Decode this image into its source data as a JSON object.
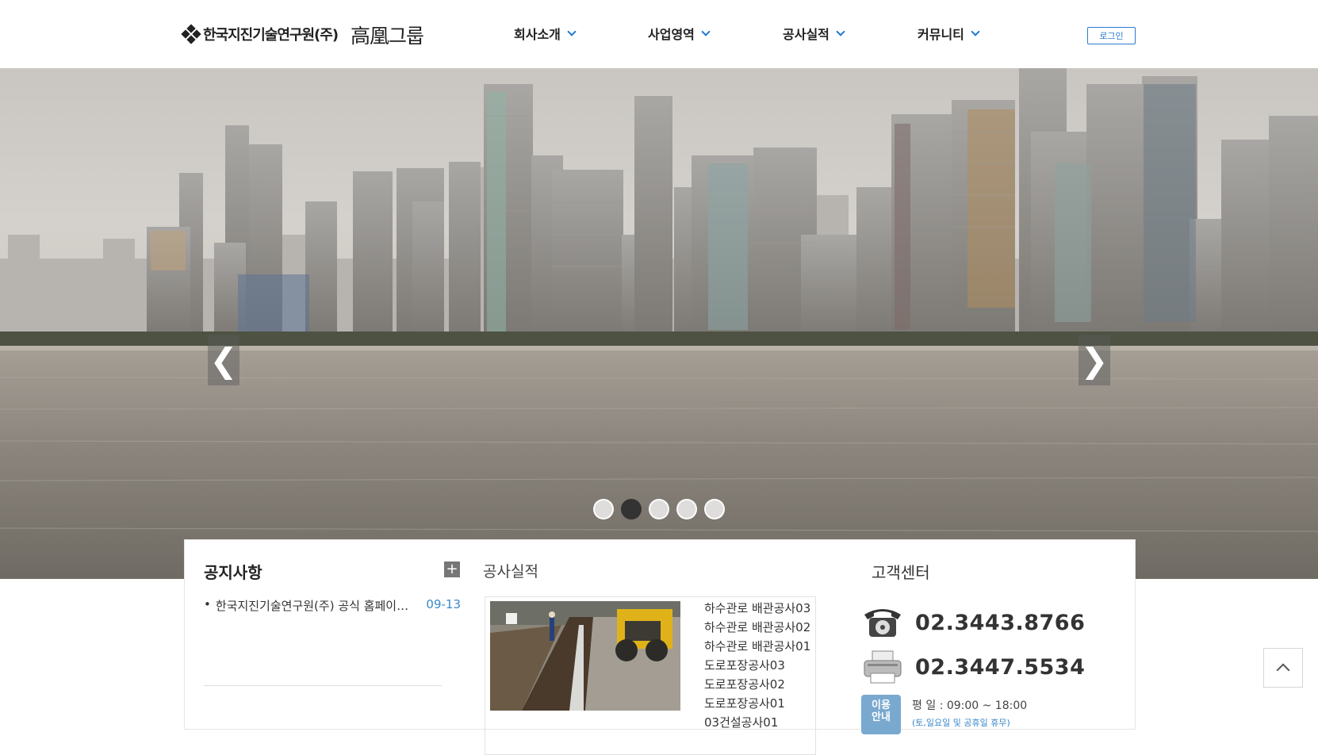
{
  "header": {
    "logo_text": "한국지진기술연구원(주)",
    "group_text": "高凰그룹",
    "nav": [
      {
        "label": "회사소개"
      },
      {
        "label": "사업영역"
      },
      {
        "label": "공사실적"
      },
      {
        "label": "커뮤니티"
      }
    ],
    "login_label": "로그인"
  },
  "hero": {
    "prev_glyph": "❮",
    "next_glyph": "❯",
    "slide_count": 5,
    "active_slide": 2
  },
  "notice": {
    "title": "공지사항",
    "more_glyph": "+",
    "items": [
      {
        "text": "한국지진기술연구원(주) 공식 홈페이지 오픈",
        "date": "09-13"
      }
    ]
  },
  "works": {
    "title": "공사실적",
    "items": [
      "하수관로 배관공사03",
      "하수관로 배관공사02",
      "하수관로 배관공사01",
      "도로포장공사03",
      "도로포장공사02",
      "도로포장공사01",
      "03건설공사01"
    ]
  },
  "customer_center": {
    "title": "고객센터",
    "phone": "02.3443.8766",
    "fax": "02.3447.5534",
    "info_badge": "이용\n안내",
    "hours": "평 일 : 09:00 ~ 18:00",
    "hours_note": "(토,일요일 및 공휴일 휴무)"
  },
  "colors": {
    "accent": "#1e78d2",
    "date": "#3a87c9"
  }
}
